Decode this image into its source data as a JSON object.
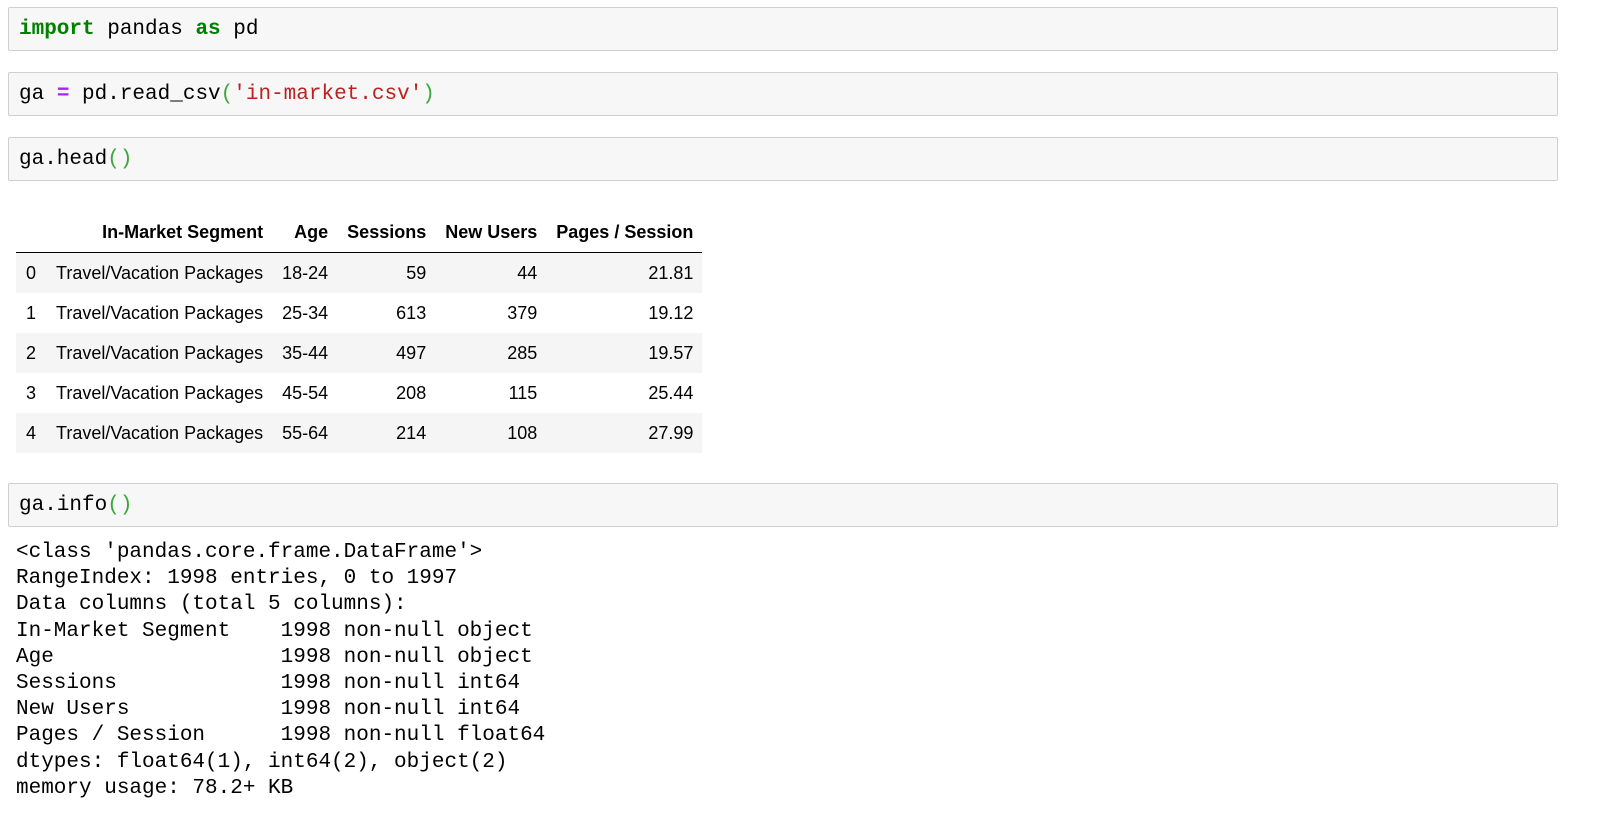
{
  "cells": {
    "import": {
      "kw_import": "import",
      "module": " pandas ",
      "kw_as": "as",
      "alias": " pd"
    },
    "read": {
      "lhs": "ga ",
      "op": "=",
      "call": " pd.read_csv",
      "open_paren": "(",
      "arg": "'in-market.csv'",
      "close_paren": ")"
    },
    "head": {
      "call": "ga.head",
      "parens": "()"
    },
    "info": {
      "call": "ga.info",
      "parens": "()"
    }
  },
  "dataframe": {
    "columns": [
      "",
      "In-Market Segment",
      "Age",
      "Sessions",
      "New Users",
      "Pages / Session"
    ],
    "rows": [
      [
        "0",
        "Travel/Vacation Packages",
        "18-24",
        "59",
        "44",
        "21.81"
      ],
      [
        "1",
        "Travel/Vacation Packages",
        "25-34",
        "613",
        "379",
        "19.12"
      ],
      [
        "2",
        "Travel/Vacation Packages",
        "35-44",
        "497",
        "285",
        "19.57"
      ],
      [
        "3",
        "Travel/Vacation Packages",
        "45-54",
        "208",
        "115",
        "25.44"
      ],
      [
        "4",
        "Travel/Vacation Packages",
        "55-64",
        "214",
        "108",
        "27.99"
      ]
    ]
  },
  "info_output": [
    "<class 'pandas.core.frame.DataFrame'>",
    "RangeIndex: 1998 entries, 0 to 1997",
    "Data columns (total 5 columns):",
    "In-Market Segment    1998 non-null object",
    "Age                  1998 non-null object",
    "Sessions             1998 non-null int64",
    "New Users            1998 non-null int64",
    "Pages / Session      1998 non-null float64",
    "dtypes: float64(1), int64(2), object(2)",
    "memory usage: 78.2+ KB"
  ]
}
